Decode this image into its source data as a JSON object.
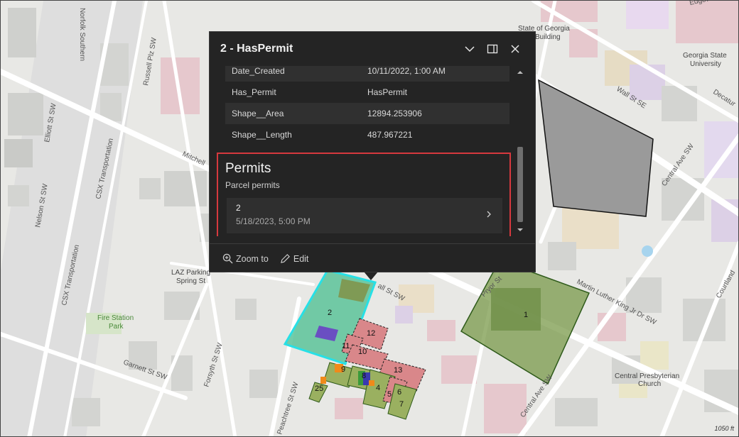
{
  "popup": {
    "title": "2 - HasPermit",
    "attributes": [
      {
        "key": "Date_Created",
        "value": "10/11/2022, 1:00 AM"
      },
      {
        "key": "Has_Permit",
        "value": "HasPermit"
      },
      {
        "key": "Shape__Area",
        "value": "12894.253906"
      },
      {
        "key": "Shape__Length",
        "value": "487.967221"
      }
    ],
    "permits": {
      "title": "Permits",
      "subtitle": "Parcel permits",
      "item_name": "2",
      "item_date": "5/18/2023, 5:00 PM"
    },
    "footer": {
      "zoom_label": "Zoom to",
      "edit_label": "Edit"
    }
  },
  "map": {
    "streets": {
      "norfolk": "Norfolk Southern",
      "russell": "Russell Plz SW",
      "elliott": "Elliott St SW",
      "csx1": "CSX Transportation",
      "csx2": "CSX Transportation",
      "nelson": "Nelson St SW",
      "mitchell": "Mitchell",
      "garnett": "Garnett St SW",
      "forsyth": "Forsyth St SW",
      "peachtree": "Peachtree St SW",
      "wall": "Wall St SE",
      "central1": "Central Ave SW",
      "central2": "Central Ave SW",
      "decatur": "Decatur",
      "mlk": "Martin Luther King Jr Dr SW",
      "pryor": "Pryor St",
      "courtland": "Courtland",
      "edgewood": "Edgewood Ave",
      "allst": "all St SW"
    },
    "pois": {
      "state_building_1": "State of Georgia",
      "state_building_2": "Building",
      "gsu_1": "Georgia State",
      "gsu_2": "University",
      "laz_1": "LAZ Parking",
      "laz_2": "Spring St",
      "fire_1": "Fire Station",
      "fire_2": "Park",
      "church_1": "Central Presbyterian",
      "church_2": "Church"
    },
    "parcels": [
      "1",
      "2",
      "5",
      "6",
      "7",
      "8",
      "9",
      "10",
      "11",
      "12",
      "13",
      "4",
      "25"
    ],
    "scale": "1050 ft",
    "colors": {
      "permit_parcel": "#7a9a4a",
      "selected_fill": "#5cc39a",
      "selected_outline": "#27e0e6",
      "no_permit": "#d9878a",
      "purple": "#6a4fc2",
      "orange": "#f08a1a"
    }
  }
}
